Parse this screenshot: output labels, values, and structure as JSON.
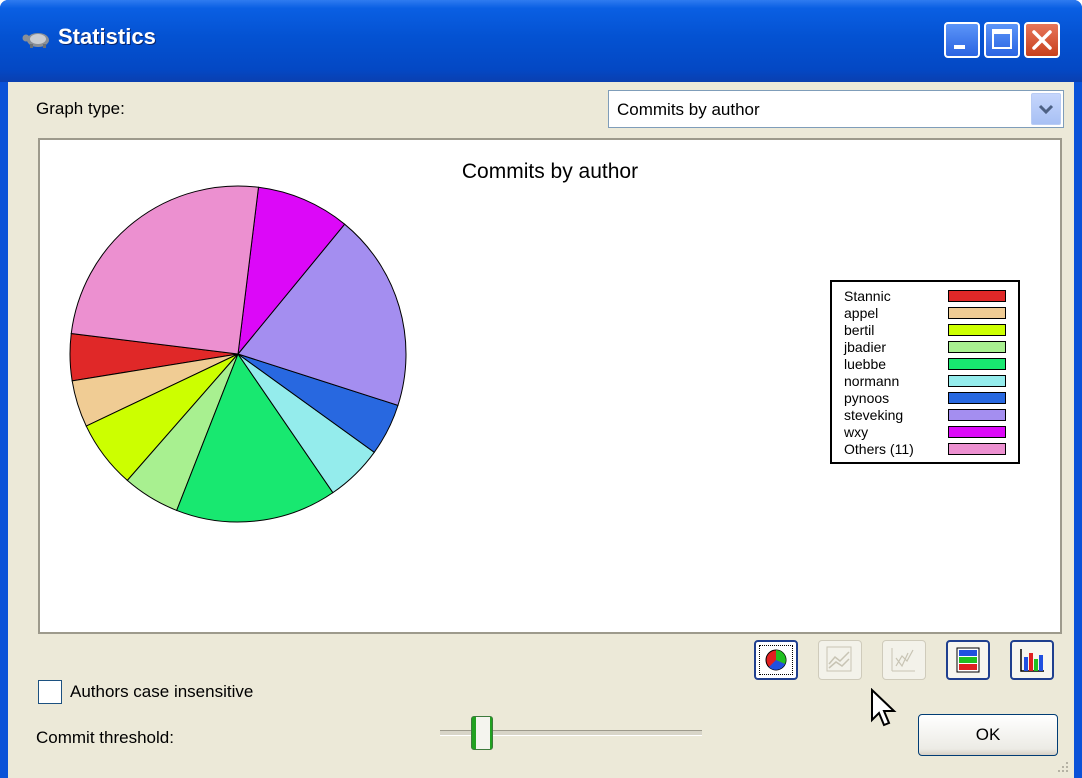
{
  "window": {
    "title": "Statistics"
  },
  "graph_type": {
    "label": "Graph type:",
    "selected": "Commits by author"
  },
  "chart_data": {
    "type": "pie",
    "title": "Commits by author",
    "legend_position": "right",
    "series": [
      {
        "name": "Stannic",
        "value": 4.5,
        "color": "#e02828"
      },
      {
        "name": "appel",
        "value": 4.5,
        "color": "#f0cc94"
      },
      {
        "name": "bertil",
        "value": 6.5,
        "color": "#ccff00"
      },
      {
        "name": "jbadier",
        "value": 5.5,
        "color": "#a8f090"
      },
      {
        "name": "luebbe",
        "value": 15.5,
        "color": "#18e870"
      },
      {
        "name": "normann",
        "value": 5.5,
        "color": "#94ecec"
      },
      {
        "name": "pynoos",
        "value": 5,
        "color": "#2868e0"
      },
      {
        "name": "steveking",
        "value": 19,
        "color": "#a48ef0"
      },
      {
        "name": "wxy",
        "value": 9,
        "color": "#dc08f8"
      },
      {
        "name": "Others (11)",
        "value": 25,
        "color": "#ec90d0"
      }
    ]
  },
  "toolbar": [
    {
      "name": "pie-chart-button",
      "icon": "pie-chart-icon",
      "state": "active"
    },
    {
      "name": "line-chart-button",
      "icon": "line-chart-icon",
      "state": "disabled"
    },
    {
      "name": "scatter-chart-button",
      "icon": "scatter-chart-icon",
      "state": "disabled"
    },
    {
      "name": "stacked-bar-button",
      "icon": "stacked-bar-icon",
      "state": "normal"
    },
    {
      "name": "bar-chart-button",
      "icon": "bar-chart-icon",
      "state": "normal"
    }
  ],
  "options": {
    "case_insensitive_label": "Authors case insensitive",
    "case_insensitive_checked": false
  },
  "threshold": {
    "label": "Commit threshold:",
    "level": 0.13
  },
  "buttons": {
    "ok": "OK"
  }
}
